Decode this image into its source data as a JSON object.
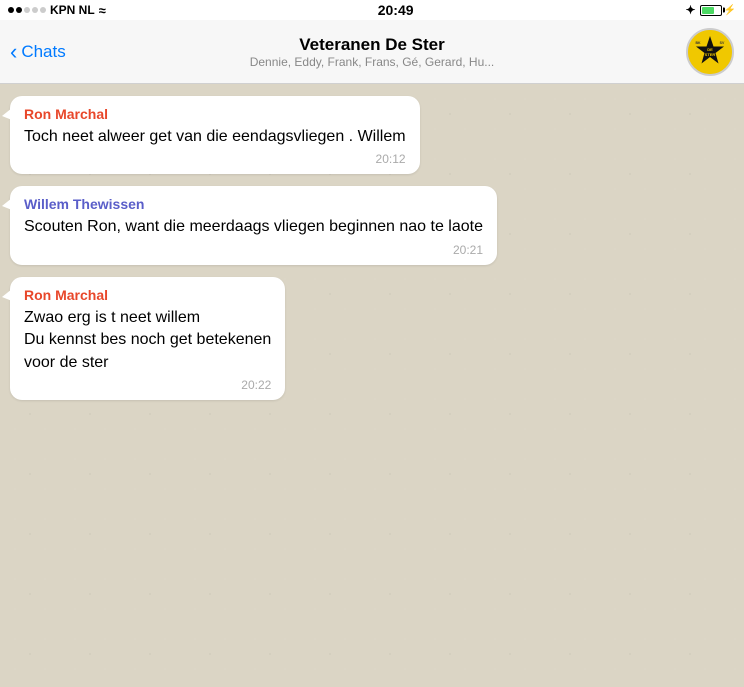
{
  "statusBar": {
    "carrier": "KPN NL",
    "time": "20:49",
    "signal": [
      true,
      true,
      false,
      false,
      false
    ],
    "wifi": true,
    "bluetooth": true,
    "battery": 70
  },
  "navBar": {
    "backLabel": "Chats",
    "title": "Veteranen De Ster",
    "subtitle": "Dennie, Eddy, Frank, Frans, Gé, Gerard, Hu...",
    "groupIconAlt": "Veteranen De Ster group icon"
  },
  "messages": [
    {
      "id": 1,
      "sender": "Ron Marchal",
      "senderClass": "sender-ron",
      "text": "Toch neet alweer get van die eendagsvliegen . Willem",
      "time": "20:12"
    },
    {
      "id": 2,
      "sender": "Willem Thewissen",
      "senderClass": "sender-willem",
      "text": "Scouten Ron, want die meerdaags vliegen beginnen nao te laote",
      "time": "20:21"
    },
    {
      "id": 3,
      "sender": "Ron Marchal",
      "senderClass": "sender-ron",
      "text": "Zwao erg is t neet willem\nDu kennst bes noch get betekenen\nvoor de ster",
      "time": "20:22"
    }
  ]
}
